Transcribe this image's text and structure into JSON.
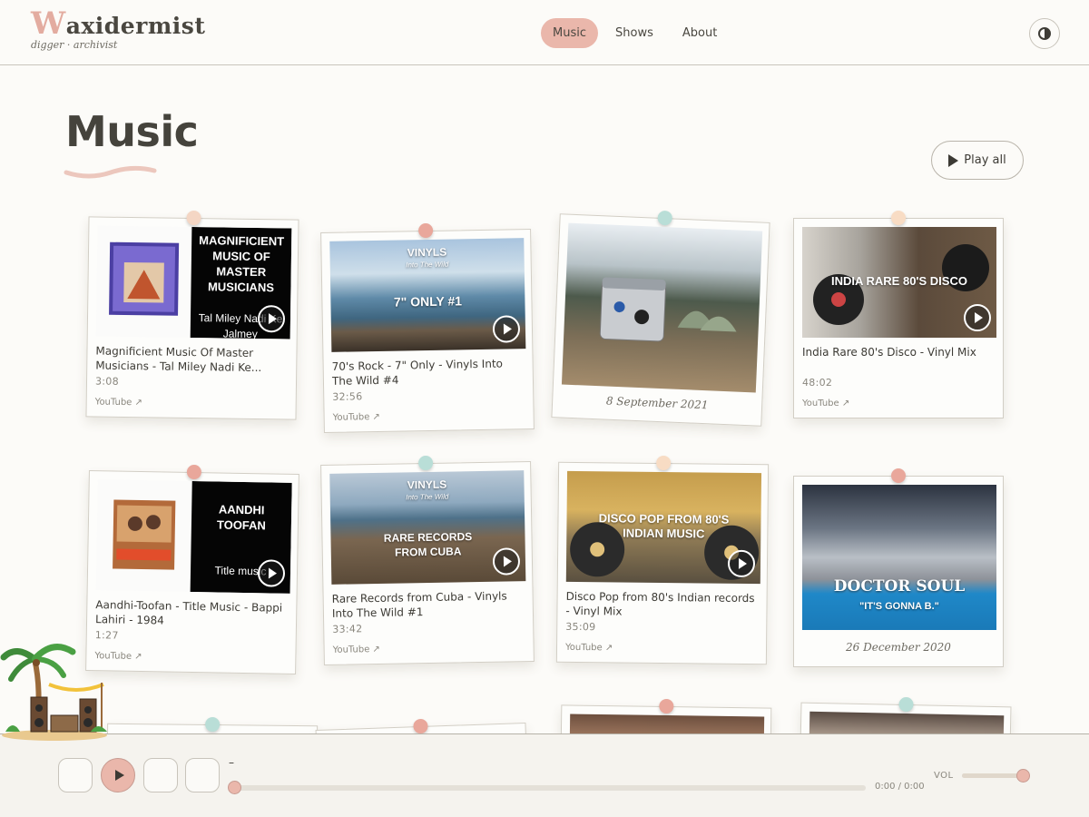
{
  "header": {
    "logo_initial": "W",
    "logo_rest": "axidermist",
    "tagline": "digger · archivist",
    "nav": [
      {
        "label": "Music",
        "active": true
      },
      {
        "label": "Shows",
        "active": false
      },
      {
        "label": "About",
        "active": false
      }
    ],
    "theme_toggle_icon": "contrast-icon"
  },
  "page": {
    "title": "Music",
    "play_all_label": "Play all"
  },
  "cards": [
    {
      "title": "Magnificient Music Of Master Musicians - Tal Miley Nadi Ke...",
      "duration": "3:08",
      "source": "YouTube ↗",
      "art_big": "MAGNIFICIENT MUSIC OF MASTER MUSICIANS",
      "art_small": "Tal Miley Nadi Ke Jalmey"
    },
    {
      "title": "70's Rock - 7\" Only - Vinyls Into The Wild #4",
      "duration": "32:56",
      "source": "YouTube ↗",
      "art_top": "VINYLS",
      "art_sub": "Into The Wild",
      "art_main": "7\" ONLY #1"
    },
    {
      "date": "8 September 2021"
    },
    {
      "title": "India Rare 80's Disco - Vinyl Mix",
      "duration": "48:02",
      "source": "YouTube ↗",
      "art_main": "INDIA RARE 80'S DISCO"
    },
    {
      "title": "Aandhi-Toofan - Title Music - Bappi Lahiri - 1984",
      "duration": "1:27",
      "source": "YouTube ↗",
      "art_big": "AANDHI TOOFAN",
      "art_small": "Title music"
    },
    {
      "title": "Rare Records from Cuba     - Vinyls Into The Wild #1",
      "duration": "33:42",
      "source": "YouTube ↗",
      "art_top": "VINYLS",
      "art_sub": "Into The Wild",
      "art_main": "RARE RECORDS FROM CUBA"
    },
    {
      "title": "Disco Pop from 80's Indian records - Vinyl Mix",
      "duration": "35:09",
      "source": "YouTube ↗",
      "art_main": "DISCO POP FROM 80'S INDIAN MUSIC"
    },
    {
      "date": "26 December 2020",
      "art_text": "DOCTOR SOUL",
      "art_sub": "\"IT'S GONNA B.\""
    }
  ],
  "player": {
    "track_title": "–",
    "time": "0:00 / 0:00",
    "vol_label": "VOL",
    "progress": 0,
    "volume": 0.95
  },
  "colors": {
    "accent": "#eab7ab",
    "background": "#fcfbf8",
    "text": "#3c3a34"
  }
}
